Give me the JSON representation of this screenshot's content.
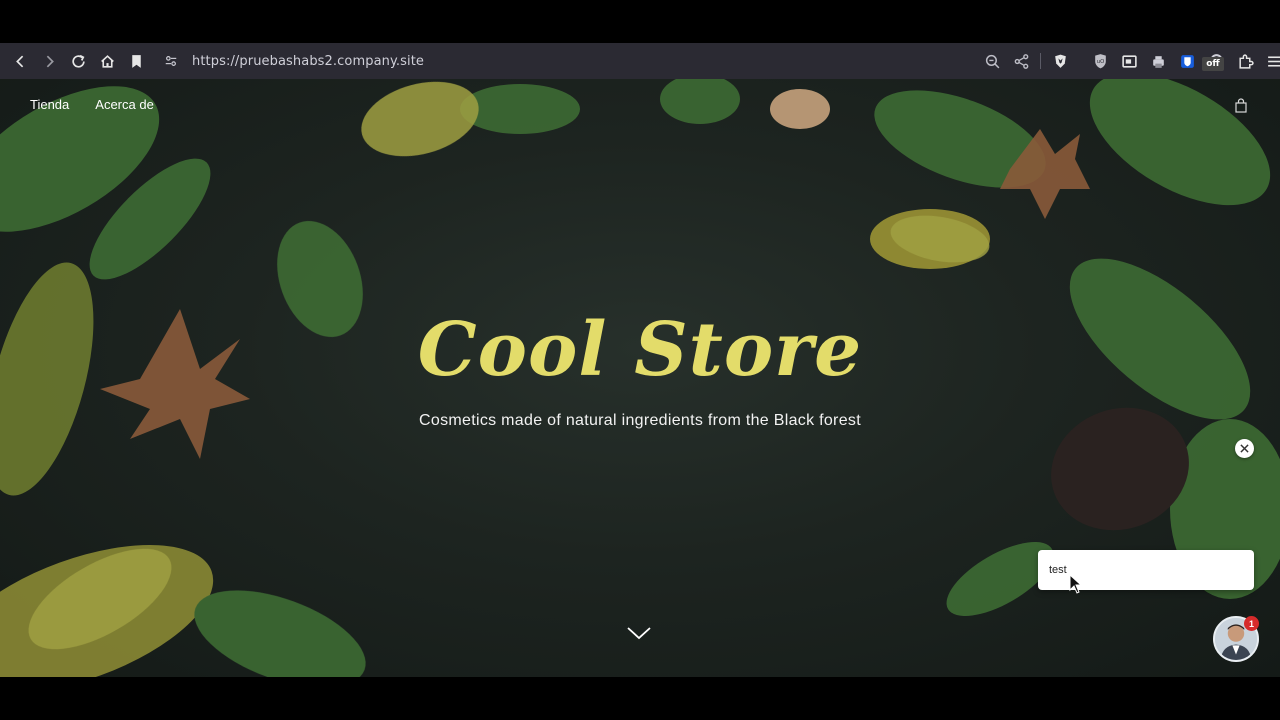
{
  "browser": {
    "url": "https://pruebashabs2.company.site",
    "extension_badge": "off",
    "icons": [
      "back-icon",
      "forward-icon",
      "reload-icon",
      "home-icon",
      "bookmark-icon",
      "site-info-icon",
      "zoom-icon",
      "share-icon",
      "brave-shields-icon",
      "ublock-icon",
      "window-icon",
      "printer-icon",
      "bitwarden-icon",
      "off-extension-icon",
      "extensions-icon",
      "menu-icon"
    ]
  },
  "site": {
    "nav": [
      {
        "label": "Tienda"
      },
      {
        "label": "Acerca de"
      }
    ],
    "hero": {
      "title": "Cool Store",
      "subtitle": "Cosmetics made of natural ingredients from the Black forest"
    }
  },
  "chat": {
    "message": "test",
    "unread_count": "1"
  },
  "colors": {
    "title": "#e3dc6a",
    "toolbar": "#2b2a33",
    "badge": "#d62b2b"
  }
}
